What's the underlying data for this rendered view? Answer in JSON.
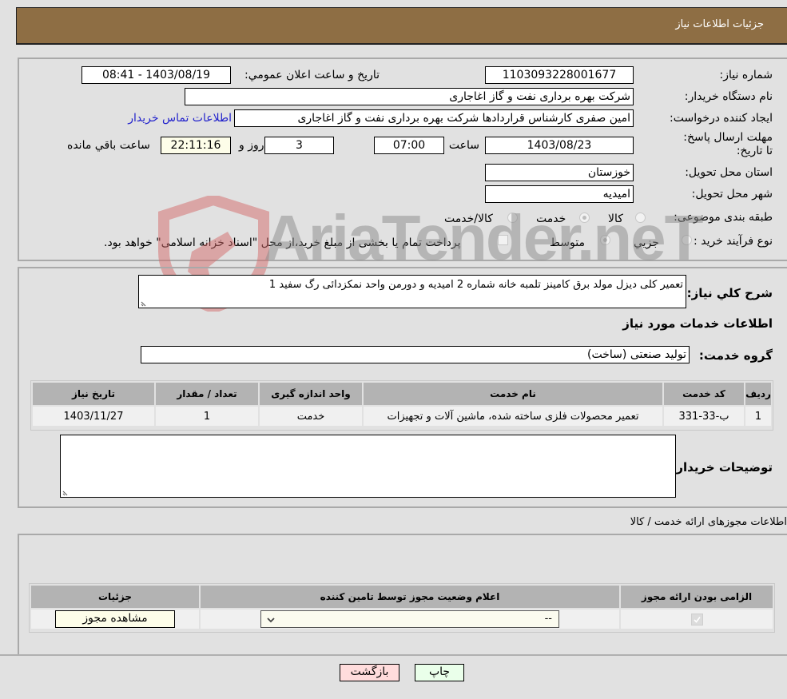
{
  "header": {
    "title": "جزئیات اطلاعات نیاز"
  },
  "fields": {
    "need_number": {
      "label": "شماره نیاز:",
      "value": "1103093228001677"
    },
    "announce_datetime": {
      "label": "تاریخ و ساعت اعلان عمومي:",
      "value": "1403/08/19 - 08:41"
    },
    "buyer_org": {
      "label": "نام دستگاه خریدار:",
      "value": "شرکت بهره برداری نفت و گاز اغاجاری"
    },
    "requester": {
      "label": "ایجاد کننده درخواست:",
      "value": "امین صفری کارشناس قراردادها شرکت بهره برداری نفت و گاز اغاجاری",
      "contact_link": "اطلاعات تماس خریدار"
    },
    "deadline": {
      "label": "مهلت ارسال پاسخ: تا تاریخ:",
      "date": "1403/08/23",
      "time_label": "ساعت",
      "time": "07:00",
      "days": "3",
      "days_label": "روز و",
      "remaining": "22:11:16",
      "remaining_label": "ساعت باقي مانده"
    },
    "province": {
      "label": "استان محل تحویل:",
      "value": "خوزستان"
    },
    "city": {
      "label": "شهر محل تحویل:",
      "value": "امیدیه"
    },
    "category": {
      "label": "طبقه بندی موضوعی:",
      "options": [
        "کالا",
        "خدمت",
        "کالا/خدمت"
      ],
      "selected": "خدمت"
    },
    "purchase_type": {
      "label": "نوع فرآیند خرید :",
      "options": [
        "جزيي",
        "متوسط"
      ],
      "selected": "متوسط",
      "treasury_note": "پرداخت تمام یا بخشی از مبلغ خرید،از محل \"اسناد خزانه اسلامی\" خواهد بود."
    }
  },
  "description": {
    "label": "شرح کلي نیاز:",
    "value": "تعمیر کلی دیزل مولد برق کامینز تلمبه خانه شماره 2 امیدیه و دورمن واحد نمکزدائی رگ سفید 1"
  },
  "services_section": {
    "title": "اطلاعات خدمات مورد نیاز",
    "group_label": "گروه خدمت:",
    "group_value": "تولید صنعتی (ساخت)",
    "table": {
      "headers": [
        "ردیف",
        "کد خدمت",
        "نام خدمت",
        "واحد اندازه گیری",
        "تعداد / مقدار",
        "تاریخ نیاز"
      ],
      "rows": [
        [
          "1",
          "ب-33-331",
          "تعمیر محصولات فلزی ساخته شده، ماشین آلات و تجهیزات",
          "خدمت",
          "1",
          "1403/11/27"
        ]
      ]
    }
  },
  "buyer_notes": {
    "label": "توضیحات خریدار:",
    "value": ""
  },
  "permits_section": {
    "title": "اطلاعات مجوزهای ارائه خدمت / کالا",
    "headers": [
      "الزامی بودن ارائه مجوز",
      "اعلام وضعیت مجوز توسط تامین کننده",
      "جزئیات"
    ],
    "row": {
      "required_checked": true,
      "status_value": "--",
      "details_button": "مشاهده مجوز"
    }
  },
  "buttons": {
    "print": "چاپ",
    "back": "بازگشت"
  },
  "watermark": {
    "text": "AriaTender.neT"
  }
}
